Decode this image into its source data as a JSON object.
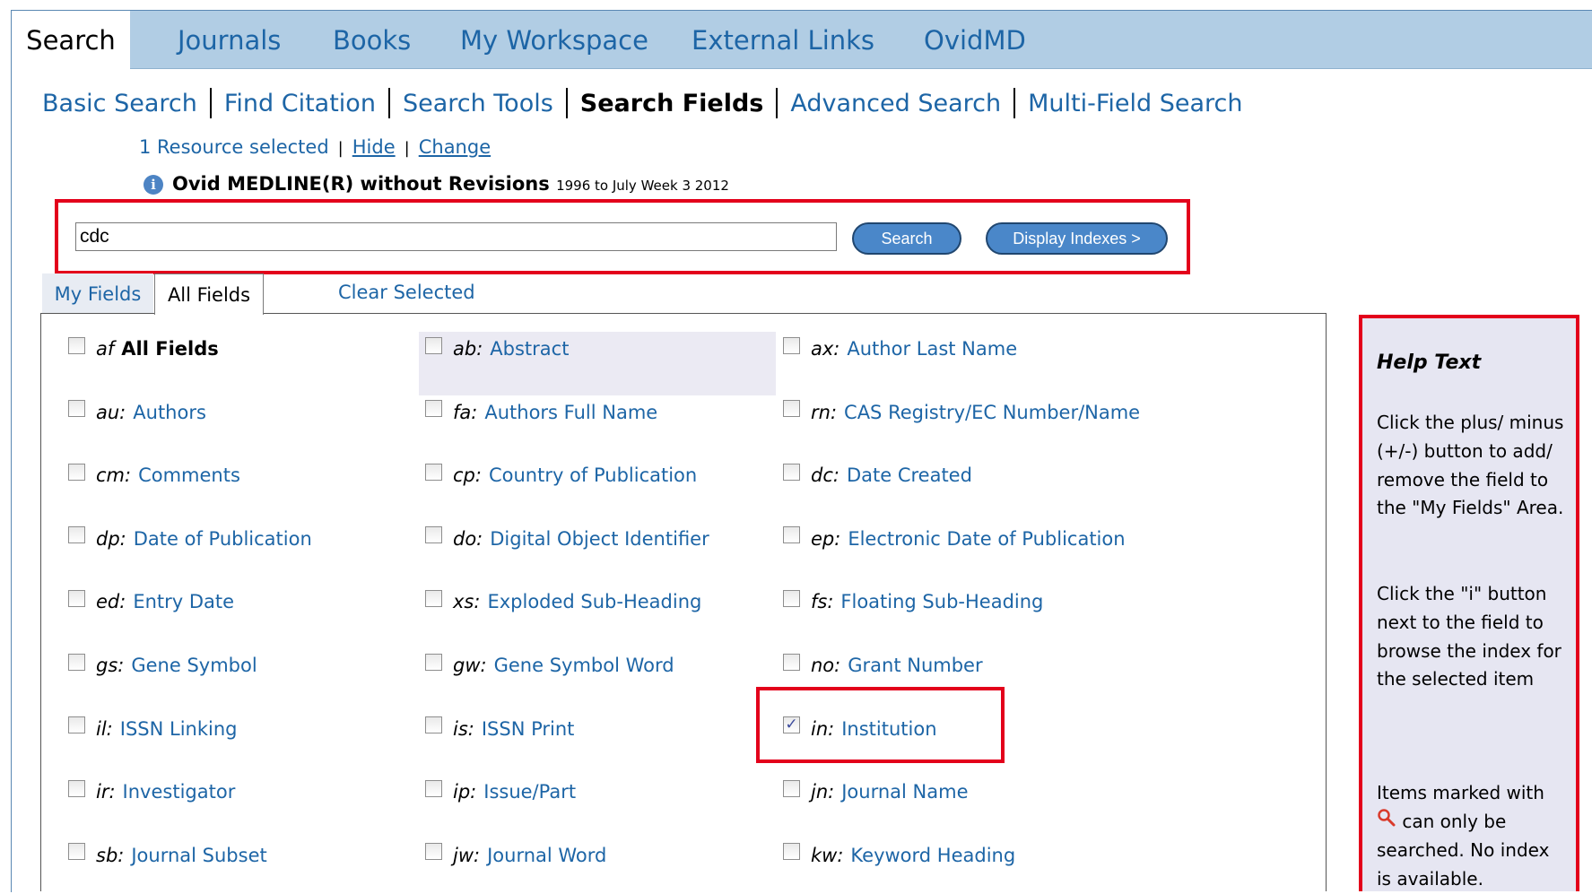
{
  "nav": {
    "tabs": [
      "Search",
      "Journals",
      "Books",
      "My Workspace",
      "External Links",
      "OvidMD"
    ]
  },
  "subnav": {
    "items": [
      "Basic Search",
      "Find Citation",
      "Search Tools",
      "Search Fields",
      "Advanced Search",
      "Multi-Field Search"
    ],
    "current": "Search Fields"
  },
  "resource": {
    "count_text": "1 Resource selected",
    "hide": "Hide",
    "change": "Change",
    "db_name": "Ovid MEDLINE(R) without Revisions",
    "db_range": "1996 to July Week 3 2012"
  },
  "search": {
    "value": "cdc",
    "search_button": "Search",
    "display_indexes_button": "Display Indexes >"
  },
  "field_tabs": {
    "my_fields": "My Fields",
    "all_fields": "All Fields",
    "clear_selected": "Clear Selected"
  },
  "fields": [
    {
      "code": "af",
      "label": "All Fields",
      "checked": false
    },
    {
      "code": "ab:",
      "label": "Abstract",
      "checked": false
    },
    {
      "code": "ax:",
      "label": "Author Last Name",
      "checked": false
    },
    {
      "code": "au:",
      "label": "Authors",
      "checked": false
    },
    {
      "code": "fa:",
      "label": "Authors Full Name",
      "checked": false
    },
    {
      "code": "rn:",
      "label": "CAS Registry/EC Number/Name",
      "checked": false
    },
    {
      "code": "cm:",
      "label": "Comments",
      "checked": false
    },
    {
      "code": "cp:",
      "label": "Country of Publication",
      "checked": false
    },
    {
      "code": "dc:",
      "label": "Date Created",
      "checked": false
    },
    {
      "code": "dp:",
      "label": "Date of Publication",
      "checked": false
    },
    {
      "code": "do:",
      "label": "Digital Object Identifier",
      "checked": false
    },
    {
      "code": "ep:",
      "label": "Electronic Date of Publication",
      "checked": false
    },
    {
      "code": "ed:",
      "label": "Entry Date",
      "checked": false
    },
    {
      "code": "xs:",
      "label": "Exploded Sub-Heading",
      "checked": false
    },
    {
      "code": "fs:",
      "label": "Floating Sub-Heading",
      "checked": false
    },
    {
      "code": "gs:",
      "label": "Gene Symbol",
      "checked": false
    },
    {
      "code": "gw:",
      "label": "Gene Symbol Word",
      "checked": false
    },
    {
      "code": "no:",
      "label": "Grant Number",
      "checked": false
    },
    {
      "code": "il:",
      "label": "ISSN Linking",
      "checked": false
    },
    {
      "code": "is:",
      "label": "ISSN Print",
      "checked": false
    },
    {
      "code": "in:",
      "label": "Institution",
      "checked": true
    },
    {
      "code": "ir:",
      "label": "Investigator",
      "checked": false
    },
    {
      "code": "ip:",
      "label": "Issue/Part",
      "checked": false
    },
    {
      "code": "jn:",
      "label": "Journal Name",
      "checked": false
    },
    {
      "code": "sb:",
      "label": "Journal Subset",
      "checked": false
    },
    {
      "code": "jw:",
      "label": "Journal Word",
      "checked": false
    },
    {
      "code": "kw:",
      "label": "Keyword Heading",
      "checked": false
    }
  ],
  "help": {
    "title": "Help Text",
    "para1": "Click the plus/ minus (+/-) button to add/ remove the field to the \"My Fields\" Area.",
    "para2": "Click the \"i\" button next to the field to browse the index for the selected item",
    "para3_prefix": "Items marked with",
    "para3_suffix": "can only be searched. No index is available.",
    "icon": "magnifier-icon"
  },
  "colors": {
    "nav_bg": "#b1cde4",
    "link": "#1d65a6",
    "highlight_red": "#e3001b",
    "button_blue": "#4a87c9",
    "help_bg": "#e6e6f2"
  }
}
